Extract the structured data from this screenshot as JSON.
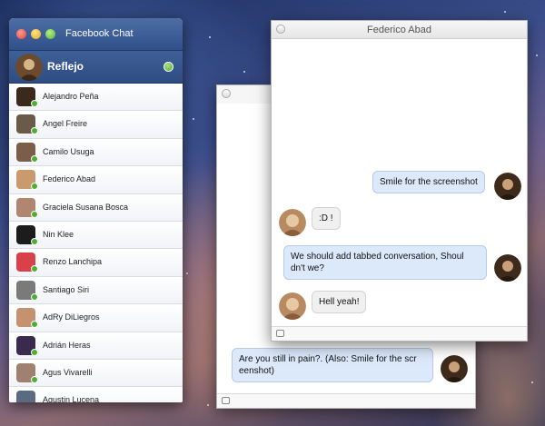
{
  "buddy_window": {
    "title": "Facebook Chat",
    "self_name": "Reflejo",
    "contacts": [
      {
        "name": "Alejandro Peña",
        "color": "#3a2a1c"
      },
      {
        "name": "Angel Freire",
        "color": "#6a5a48"
      },
      {
        "name": "Camilo Usuga",
        "color": "#7b5e4a"
      },
      {
        "name": "Federico Abad",
        "color": "#c89a6e"
      },
      {
        "name": "Graciela Susana Bosca",
        "color": "#b08670"
      },
      {
        "name": "Nin Klee",
        "color": "#1c1c1c"
      },
      {
        "name": "Renzo Lanchipa",
        "color": "#d8404a"
      },
      {
        "name": "Santiago Siri",
        "color": "#7a7a7a"
      },
      {
        "name": "AdRy DiLiegros",
        "color": "#c49270"
      },
      {
        "name": "Adrián Heras",
        "color": "#3a2a4e"
      },
      {
        "name": "Agus Vivarelli",
        "color": "#a08070"
      },
      {
        "name": "Agustin Lucena",
        "color": "#5a6a80"
      }
    ]
  },
  "chat_front": {
    "title": "Federico Abad",
    "messages": [
      {
        "text": "Smile for the screenshot",
        "direction": "out"
      },
      {
        "text": ":D !",
        "direction": "in"
      },
      {
        "text": "We should add tabbed conversation, Shouldn't we?",
        "line1": "We should add tabbed conversation, Shoul",
        "line2": "dn't we?",
        "direction": "out"
      },
      {
        "text": "Hell yeah!",
        "direction": "in"
      }
    ]
  },
  "chat_back": {
    "title": "",
    "messages": [
      {
        "line1": "Are you still in pain?. (Also: Smile for the scr",
        "line2": "eenshot)",
        "direction": "out"
      }
    ]
  },
  "colors": {
    "status_online": "#4caf30",
    "bubble_out": "#dbe9fb",
    "bubble_in": "#f0f0f0"
  }
}
